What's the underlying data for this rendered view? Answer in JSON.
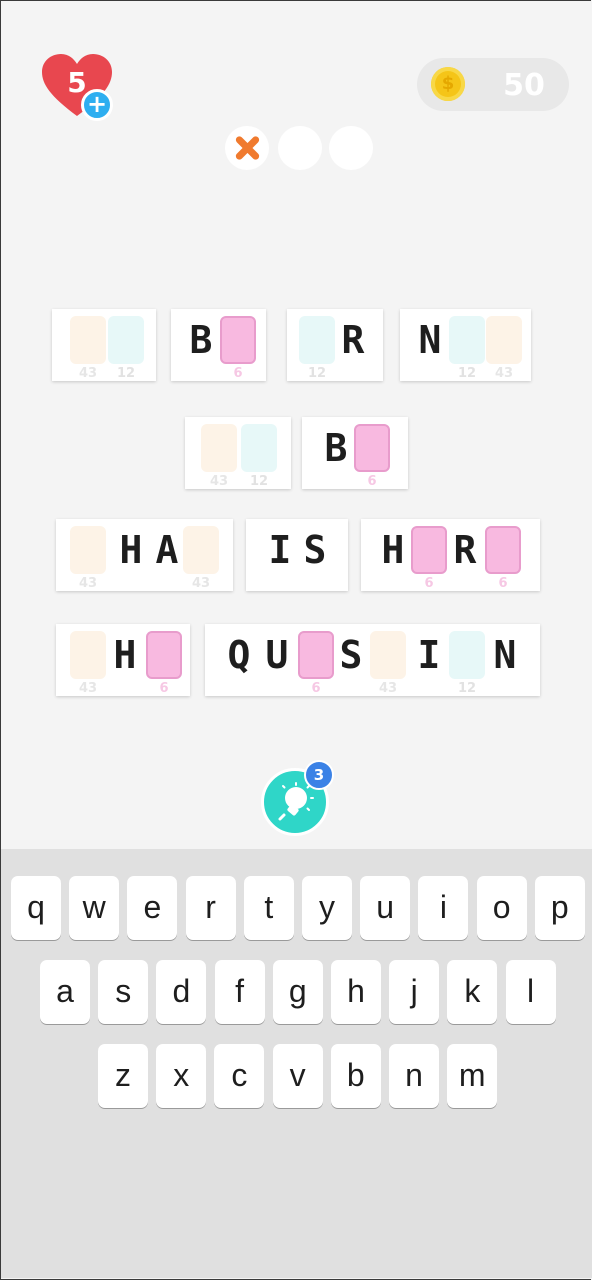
{
  "header": {
    "lives": "5",
    "lives_plus": "+",
    "coins": "50",
    "coin_symbol": "$",
    "strikes": [
      "x",
      "",
      ""
    ]
  },
  "puzzle": {
    "words": [
      {
        "cells": [
          {
            "l": "",
            "slot": "peach",
            "n": "43"
          },
          {
            "l": "",
            "slot": "cyan",
            "n": "12"
          }
        ]
      },
      {
        "cells": [
          {
            "l": "B",
            "slot": "",
            "n": ""
          },
          {
            "l": "",
            "slot": "pink",
            "n": "6"
          }
        ]
      },
      {
        "cells": [
          {
            "l": "",
            "slot": "cyan",
            "n": "12"
          },
          {
            "l": "R",
            "slot": "",
            "n": ""
          }
        ]
      },
      {
        "cells": [
          {
            "l": "N",
            "slot": "",
            "n": ""
          },
          {
            "l": "",
            "slot": "cyan",
            "n": "12"
          },
          {
            "l": "",
            "slot": "peach",
            "n": "43"
          }
        ]
      },
      {
        "cells": [
          {
            "l": "",
            "slot": "peach",
            "n": "43"
          },
          {
            "l": "",
            "slot": "cyan",
            "n": "12"
          }
        ]
      },
      {
        "cells": [
          {
            "l": "B",
            "slot": "",
            "n": ""
          },
          {
            "l": "",
            "slot": "pink",
            "n": "6"
          }
        ]
      },
      {
        "cells": [
          {
            "l": "",
            "slot": "peach",
            "n": "43"
          },
          {
            "l": "H",
            "slot": "",
            "n": ""
          },
          {
            "l": "A",
            "slot": "",
            "n": ""
          },
          {
            "l": "",
            "slot": "peach",
            "n": "43"
          }
        ]
      },
      {
        "cells": [
          {
            "l": "I",
            "slot": "",
            "n": ""
          },
          {
            "l": "S",
            "slot": "",
            "n": ""
          }
        ]
      },
      {
        "cells": [
          {
            "l": "H",
            "slot": "",
            "n": ""
          },
          {
            "l": "",
            "slot": "pink",
            "n": "6"
          },
          {
            "l": "R",
            "slot": "",
            "n": ""
          },
          {
            "l": "",
            "slot": "pink",
            "n": "6"
          }
        ]
      },
      {
        "cells": [
          {
            "l": "",
            "slot": "peach",
            "n": "43"
          },
          {
            "l": "H",
            "slot": "",
            "n": ""
          },
          {
            "l": "",
            "slot": "pink",
            "n": "6"
          }
        ]
      },
      {
        "cells": [
          {
            "l": "Q",
            "slot": "",
            "n": ""
          },
          {
            "l": "U",
            "slot": "",
            "n": ""
          },
          {
            "l": "",
            "slot": "pink",
            "n": "6"
          },
          {
            "l": "S",
            "slot": "",
            "n": ""
          },
          {
            "l": "",
            "slot": "peach",
            "n": "43"
          },
          {
            "l": "I",
            "slot": "",
            "n": ""
          },
          {
            "l": "",
            "slot": "cyan",
            "n": "12"
          },
          {
            "l": "N",
            "slot": "",
            "n": ""
          }
        ]
      }
    ]
  },
  "hint": {
    "count": "3",
    "icon": "lightbulb-icon"
  },
  "keyboard": {
    "rows": [
      [
        "q",
        "w",
        "e",
        "r",
        "t",
        "y",
        "u",
        "i",
        "o",
        "p"
      ],
      [
        "a",
        "s",
        "d",
        "f",
        "g",
        "h",
        "j",
        "k",
        "l"
      ],
      [
        "z",
        "x",
        "c",
        "v",
        "b",
        "n",
        "m"
      ]
    ]
  },
  "colors": {
    "heart": "#e8474f",
    "plus": "#2eaef0",
    "coin": "#f5c518",
    "strike": "#f07a2e",
    "hint": "#2fd6c8",
    "badge": "#3b82e6",
    "pink_slot": "#f8b9e0",
    "peach_slot": "#fdf3e7",
    "cyan_slot": "#e7f8f8"
  }
}
